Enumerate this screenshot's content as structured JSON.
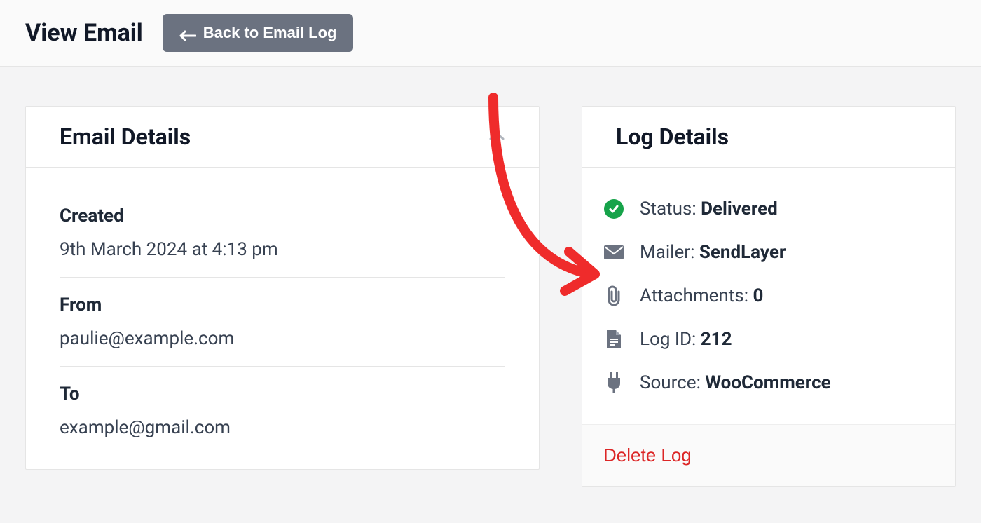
{
  "header": {
    "title": "View Email",
    "back_button": "Back to Email Log"
  },
  "email_details": {
    "heading": "Email Details",
    "created_label": "Created",
    "created_value": "9th March 2024 at 4:13 pm",
    "from_label": "From",
    "from_value": "paulie@example.com",
    "to_label": "To",
    "to_value": "example@gmail.com"
  },
  "log_details": {
    "heading": "Log Details",
    "status_label": "Status: ",
    "status_value": "Delivered",
    "mailer_label": "Mailer: ",
    "mailer_value": "SendLayer",
    "attachments_label": "Attachments: ",
    "attachments_value": "0",
    "log_id_label": "Log ID: ",
    "log_id_value": "212",
    "source_label": "Source: ",
    "source_value": "WooCommerce",
    "delete_label": "Delete Log"
  }
}
